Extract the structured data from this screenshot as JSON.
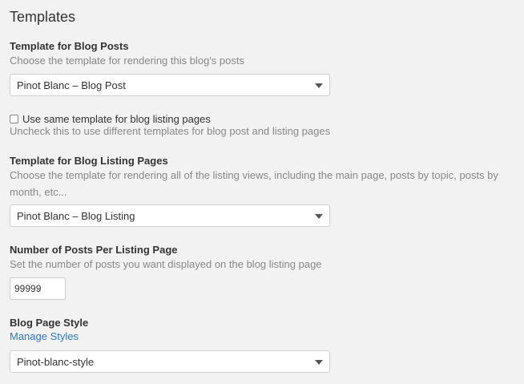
{
  "section": {
    "title": "Templates"
  },
  "blog_posts": {
    "label": "Template for Blog Posts",
    "hint": "Choose the template for rendering this blog's posts",
    "selected": "Pinot Blanc – Blog Post"
  },
  "same_template": {
    "label": "Use same template for blog listing pages",
    "checked": false,
    "hint": "Uncheck this to use different templates for blog post and listing pages"
  },
  "listing_pages": {
    "label": "Template for Blog Listing Pages",
    "hint": "Choose the template for rendering all of the listing views, including the main page, posts by topic, posts by month, etc...",
    "selected": "Pinot Blanc – Blog Listing"
  },
  "posts_per_page": {
    "label": "Number of Posts Per Listing Page",
    "hint": "Set the number of posts you want displayed on the blog listing page",
    "value": "99999"
  },
  "page_style": {
    "label": "Blog Page Style",
    "link": "Manage Styles",
    "selected": "Pinot-blanc-style"
  },
  "colors": {
    "background": "#f2f2f2",
    "text": "#333333",
    "hint": "#888888",
    "link": "#2f7ac2"
  }
}
